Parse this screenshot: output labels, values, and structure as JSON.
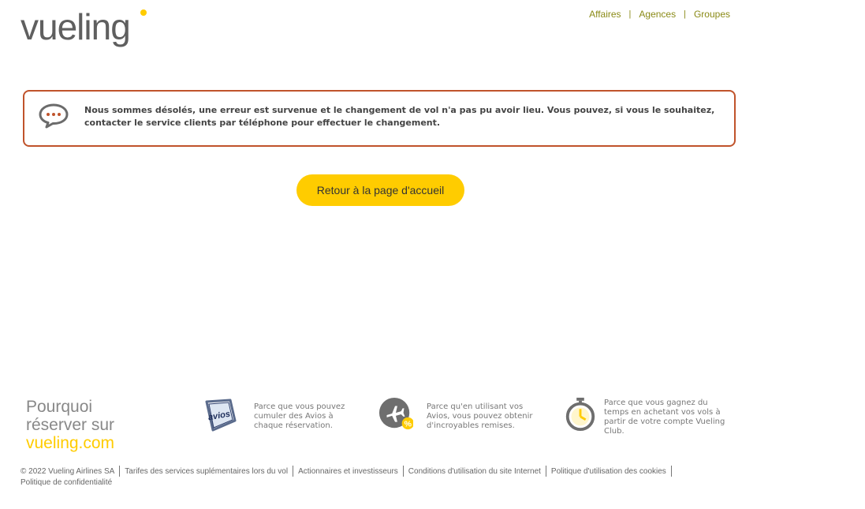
{
  "header": {
    "logo_text": "vueling",
    "nav": [
      "Affaires",
      "Agences",
      "Groupes"
    ]
  },
  "error": {
    "icon": "chat-bubble-icon",
    "message": "Nous sommes désolés, une erreur est survenue et le changement de vol n'a pas pu avoir lieu. Vous pouvez, si vous le souhaitez, contacter le service clients par téléphone pour effectuer le changement."
  },
  "home_button_label": "Retour à la page d'accueil",
  "why": {
    "line1": "Pourquoi",
    "line2": "réserver sur",
    "brand": "vueling.com"
  },
  "reasons": [
    {
      "icon": "avios-icon",
      "text": "Parce que vous pouvez cumuler des Avios à chaque réservation."
    },
    {
      "icon": "plane-discount-icon",
      "text": "Parce qu'en utilisant vos Avios, vous pouvez obtenir d'incroyables remises."
    },
    {
      "icon": "stopwatch-icon",
      "text": "Parce que vous gagnez du temps en achetant vos vols à partir de votre compte Vueling Club."
    }
  ],
  "footer": {
    "copyright": "© 2022 Vueling Airlines SA",
    "links": [
      "Tarifes des services suplémentaires lors du vol",
      "Actionnaires et investisseurs",
      "Conditions d'utilisation du site Internet",
      "Politique d'utilisation des cookies",
      "Politique de confidentialité"
    ]
  },
  "colors": {
    "brand_yellow": "#ffcc00",
    "error_border": "#c0532b",
    "nav_link": "#8a8a16"
  }
}
